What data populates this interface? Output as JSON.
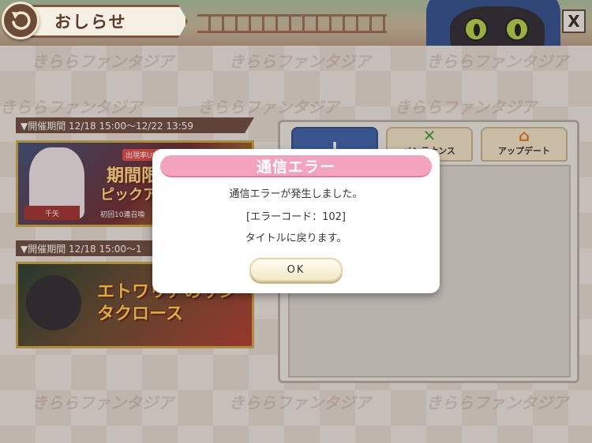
{
  "header": {
    "title": "おしらせ",
    "close_label": "X"
  },
  "watermark": "きららファンタジア",
  "events": [
    {
      "period": "▼開催期間 12/18 15:00～12/22 13:59",
      "banner_text": "期間限定",
      "banner_sub": "ピックアップ",
      "tag": "出現率UP!",
      "name_tag": "千矢",
      "footer": "初回10連召喚"
    },
    {
      "period": "▼開催期間 12/18 15:00～1",
      "banner_text": "エトワリアのサンタクロース"
    }
  ],
  "tabs": [
    {
      "label": "",
      "icon": "exclamation-icon",
      "active": true
    },
    {
      "label": "メンテナンス",
      "icon": "tools-icon",
      "active": false
    },
    {
      "label": "アップデート",
      "icon": "house-arrow-icon",
      "active": false
    }
  ],
  "dialog": {
    "title": "通信エラー",
    "message": "通信エラーが発生しました。",
    "error_code": "[エラーコード：102]",
    "return_message": "タイトルに戻ります。",
    "ok_label": "OK"
  },
  "colors": {
    "dialog_title_bg": "#f2a3bd",
    "active_tab": "#3760a8",
    "period_bar": "#6b4a3e"
  }
}
